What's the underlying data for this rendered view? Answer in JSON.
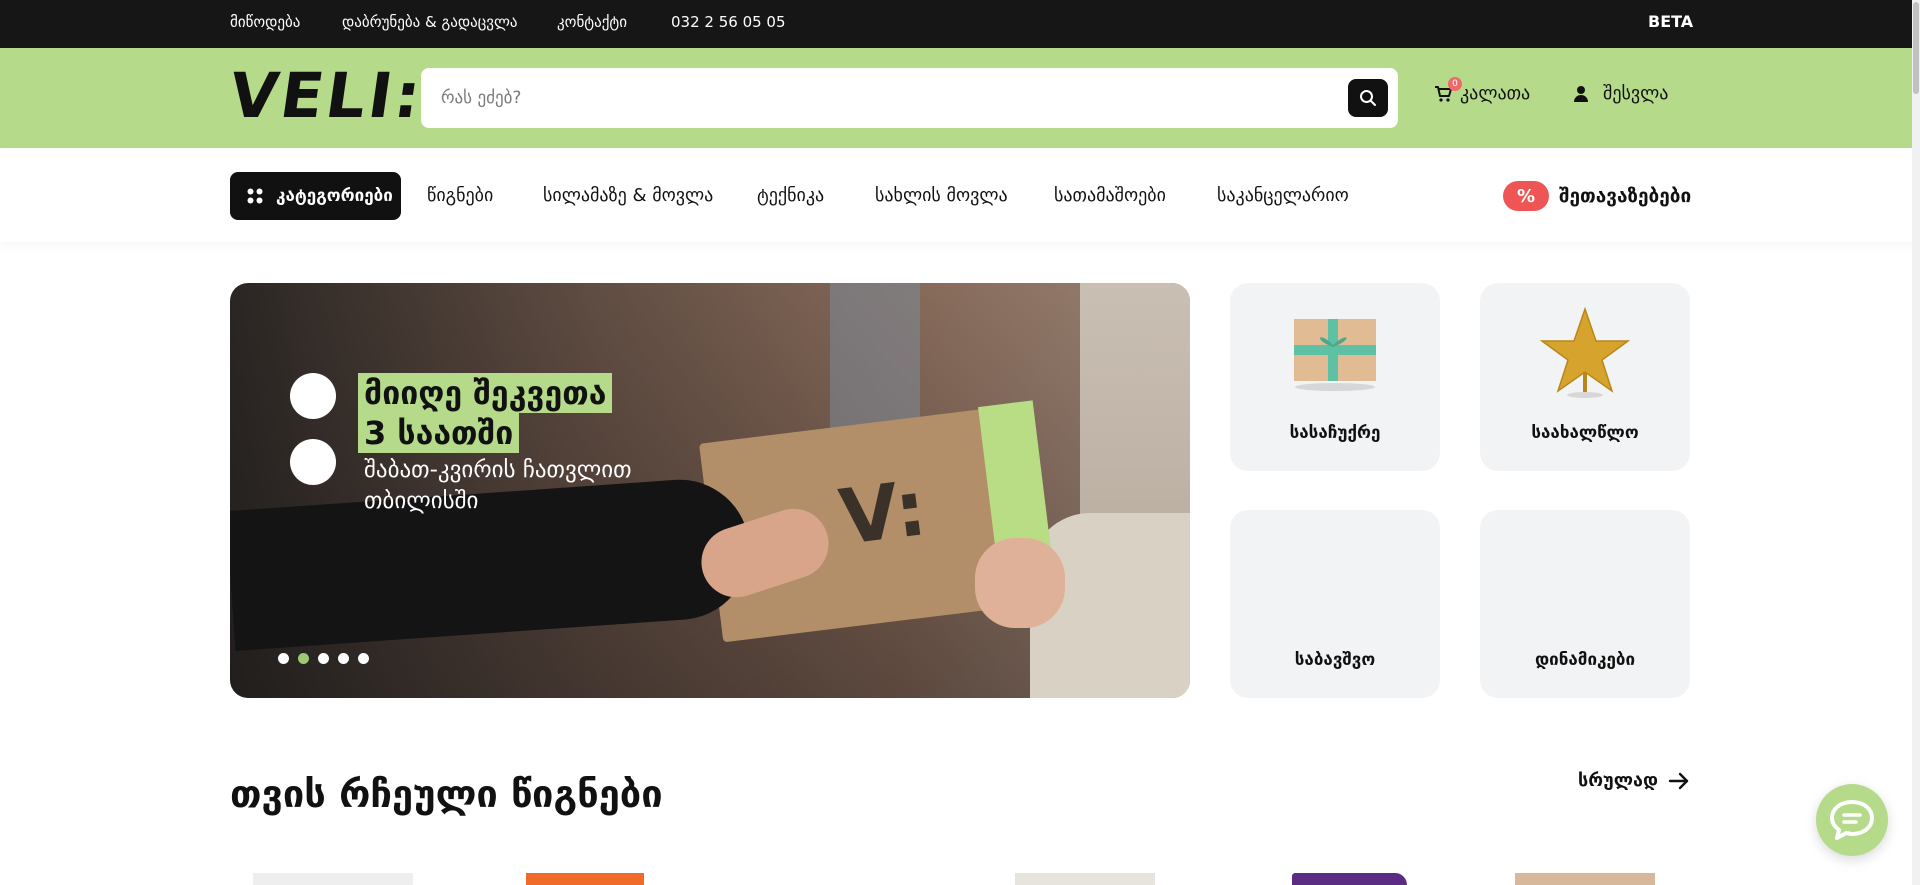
{
  "topbar": {
    "links": [
      "მიწოდება",
      "დაბრუნება & გადაცვლა",
      "კონტაქტი"
    ],
    "phone": "032 2 56 05 05",
    "beta": "BETA"
  },
  "header": {
    "logo": "VELI:",
    "search_placeholder": "რას ეძებ?",
    "cart_label": "კალათა",
    "cart_count": "0",
    "login_label": "შესვლა"
  },
  "nav": {
    "categories_button": "კატეგორიები",
    "items": [
      "წიგნები",
      "სილამაზე & მოვლა",
      "ტექნიკა",
      "სახლის მოვლა",
      "სათამაშოები",
      "საკანცელარიო"
    ],
    "promo_badge": "%",
    "promo_label": "შეთავაზებები"
  },
  "hero": {
    "headline_line1": "მიიღე შეკვეთა",
    "headline_line2": "3 საათში",
    "subtitle": "შაბათ-კვირის ჩათვლით თბილისში",
    "box_logo": "V:",
    "slides_total": 5,
    "active_slide": 2
  },
  "category_cards": [
    {
      "label": "სასაჩუქრე",
      "icon": "gift-box-icon"
    },
    {
      "label": "საახალწლო",
      "icon": "star-icon"
    },
    {
      "label": "საბავშვო",
      "icon": ""
    },
    {
      "label": "დინამიკები",
      "icon": ""
    }
  ],
  "section": {
    "title": "თვის რჩეული წიგნები",
    "view_all": "სრულად"
  },
  "colors": {
    "brand_green": "#b5db8a",
    "topbar_dark": "#161616",
    "promo_red": "#ee5656"
  }
}
